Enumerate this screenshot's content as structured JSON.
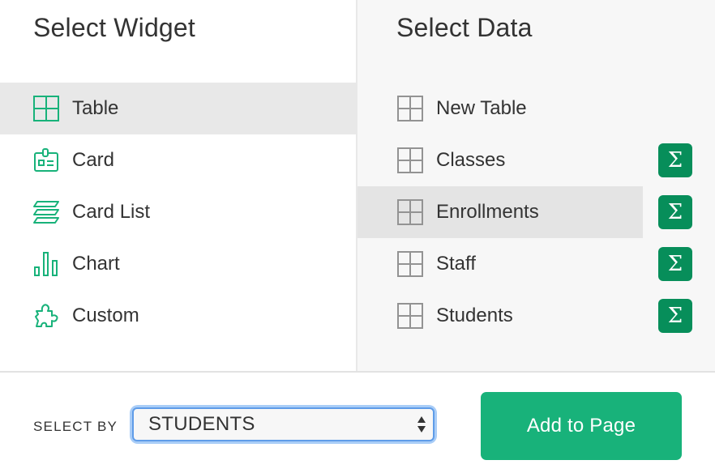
{
  "widget_panel": {
    "title": "Select Widget",
    "items": [
      {
        "label": "Table",
        "icon": "table-grid-icon",
        "selected": true
      },
      {
        "label": "Card",
        "icon": "id-card-icon",
        "selected": false
      },
      {
        "label": "Card List",
        "icon": "card-list-icon",
        "selected": false
      },
      {
        "label": "Chart",
        "icon": "bar-chart-icon",
        "selected": false
      },
      {
        "label": "Custom",
        "icon": "puzzle-piece-icon",
        "selected": false
      }
    ]
  },
  "data_panel": {
    "title": "Select Data",
    "items": [
      {
        "label": "New Table",
        "icon": "table-grid-icon",
        "has_summary": false,
        "selected": false
      },
      {
        "label": "Classes",
        "icon": "table-grid-icon",
        "has_summary": true,
        "selected": false
      },
      {
        "label": "Enrollments",
        "icon": "table-grid-icon",
        "has_summary": true,
        "selected": true
      },
      {
        "label": "Staff",
        "icon": "table-grid-icon",
        "has_summary": true,
        "selected": false
      },
      {
        "label": "Students",
        "icon": "table-grid-icon",
        "has_summary": true,
        "selected": false
      }
    ],
    "summary_symbol": "Σ"
  },
  "footer": {
    "select_by_label": "SELECT BY",
    "select_by_value": "STUDENTS",
    "add_button_label": "Add to Page"
  },
  "colors": {
    "accent_green": "#18b27a",
    "summary_green": "#078e5a",
    "icon_gray": "#939393",
    "focus_blue": "#5f9ce8"
  }
}
